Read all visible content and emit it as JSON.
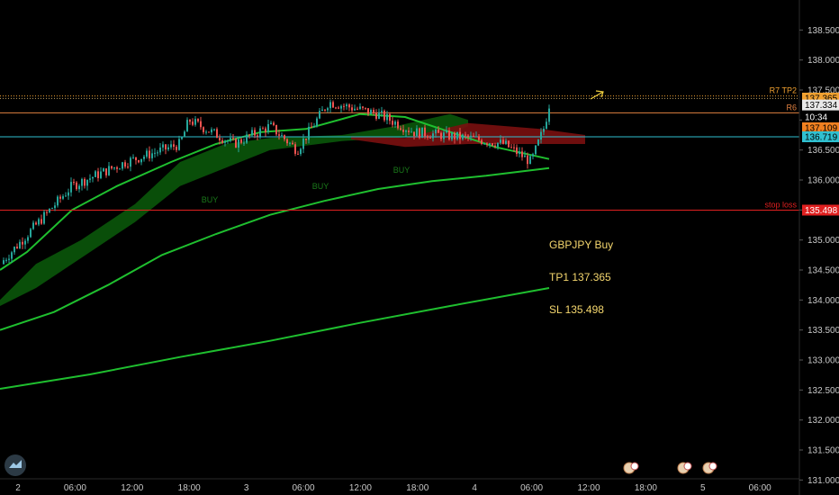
{
  "chart_data": {
    "type": "candlestick",
    "symbol": "GBPJPY",
    "y_range": [
      130.75,
      139.0
    ],
    "y_ticks": [
      "138.500",
      "138.000",
      "137.500",
      "137.000",
      "136.500",
      "136.000",
      "135.500",
      "135.000",
      "134.500",
      "134.000",
      "133.500",
      "133.000",
      "132.500",
      "132.000",
      "131.500",
      "131.000"
    ],
    "x_ticks": [
      "2",
      "06:00",
      "12:00",
      "18:00",
      "3",
      "06:00",
      "12:00",
      "18:00",
      "4",
      "06:00",
      "12:00",
      "18:00",
      "5",
      "06:00"
    ],
    "horizontal_levels": [
      {
        "name": "R7 TP2",
        "label": "R7  TP2",
        "price": 137.4,
        "color": "#f0a030",
        "style": "dotted"
      },
      {
        "name": "R6",
        "label": "R6",
        "price": 137.12,
        "color": "#e08040",
        "style": "solid"
      },
      {
        "name": "pivot",
        "label": "",
        "price": 136.72,
        "color": "#30c0d0",
        "style": "solid"
      },
      {
        "name": "stop loss",
        "label": "stop loss",
        "price": 135.498,
        "color": "#e02020",
        "style": "solid"
      }
    ],
    "price_tags": [
      {
        "text": "137.365",
        "bg": "#f0a030",
        "fg": "#000000",
        "price": 137.365
      },
      {
        "text": "137.334",
        "bg": "#e8e8e8",
        "fg": "#000000",
        "price": 137.25
      },
      {
        "text": "10:34",
        "bg": "#000000",
        "fg": "#ffffff",
        "price": 137.05
      },
      {
        "text": "137.109",
        "bg": "#f08020",
        "fg": "#000000",
        "price": 136.87
      },
      {
        "text": "136.719",
        "bg": "#30c0d0",
        "fg": "#000000",
        "price": 136.72
      },
      {
        "text": "135.498",
        "bg": "#e02020",
        "fg": "#ffffff",
        "price": 135.498
      }
    ],
    "signal_labels": [
      "BUY",
      "BUY",
      "BUY"
    ],
    "annotation_lines": [
      "GBPJPY Buy",
      "TP1 137.365",
      "SL 135.498"
    ]
  },
  "colors": {
    "background": "#000000",
    "up_candle": "#26a69a",
    "down_candle": "#ef5350",
    "ma_line": "#1fbf2f",
    "cloud_bull": "#0a5c0a",
    "cloud_bear": "#7a1010",
    "note_text": "#f5d76e"
  },
  "icons": {
    "logo": "tradingview-logo-icon",
    "events": [
      "calendar-event-icon",
      "calendar-event-icon",
      "calendar-event-icon"
    ]
  }
}
